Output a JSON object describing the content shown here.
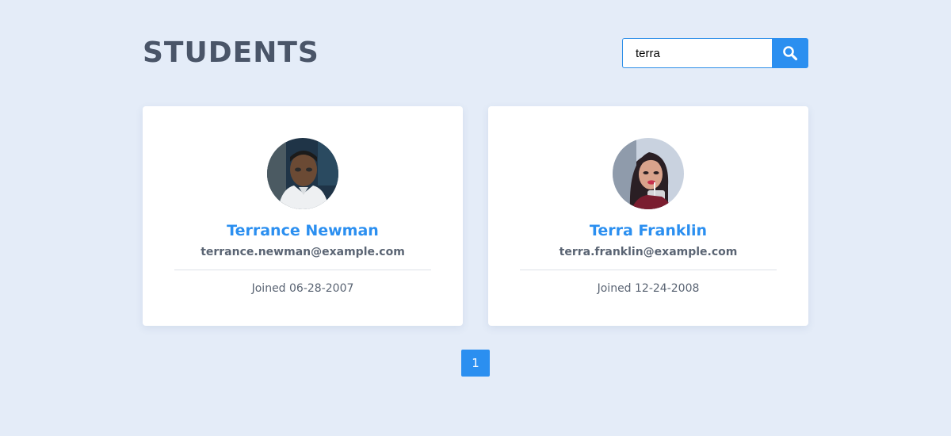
{
  "header": {
    "title": "STUDENTS"
  },
  "search": {
    "value": "terra",
    "icon": "search-icon"
  },
  "students": [
    {
      "name": "Terrance Newman",
      "email": "terrance.newman@example.com",
      "joined": "Joined 06-28-2007"
    },
    {
      "name": "Terra Franklin",
      "email": "terra.franklin@example.com",
      "joined": "Joined 12-24-2008"
    }
  ],
  "pagination": {
    "current_page": "1"
  },
  "colors": {
    "background": "#e4ecf8",
    "accent": "#2b8ff0",
    "title": "#4a5568",
    "text_muted": "#5a6473"
  }
}
